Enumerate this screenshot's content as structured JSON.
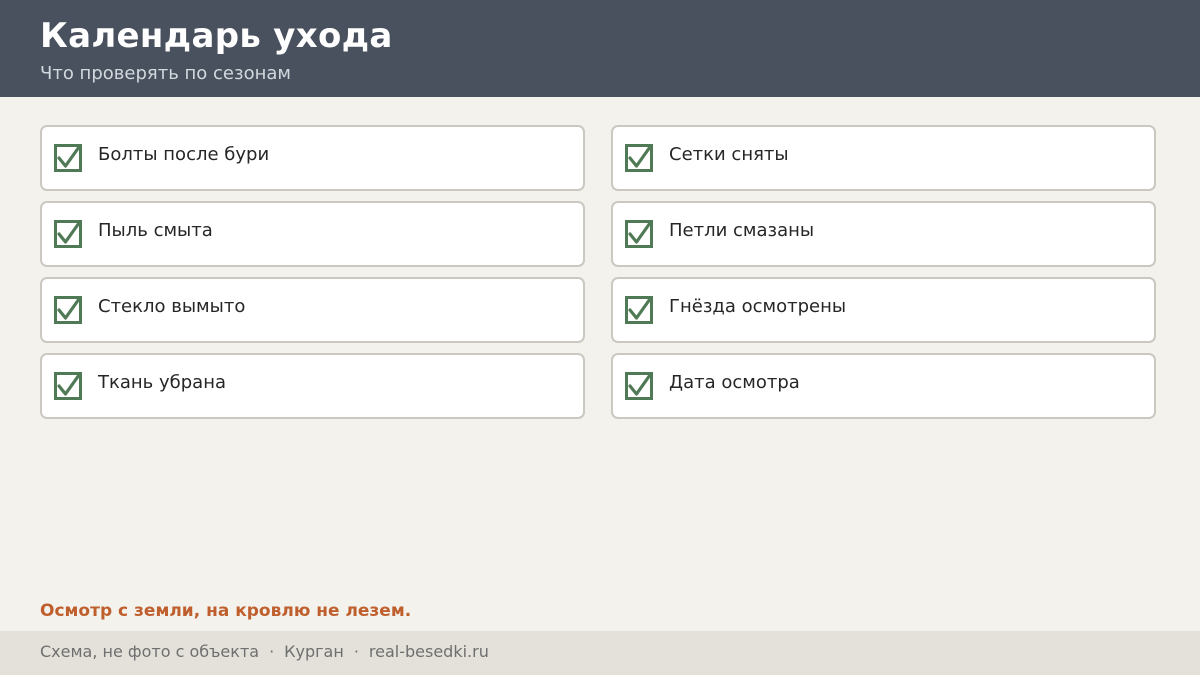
{
  "header": {
    "title": "Календарь ухода",
    "subtitle": "Что проверять по сезонам"
  },
  "colors": {
    "header_bg": "#48515d",
    "check_green": "#4f7a55",
    "warning": "#bf5f2d"
  },
  "checklist": [
    {
      "label": "Болты после бури",
      "checked": true,
      "icon": "checkbox-checked-icon"
    },
    {
      "label": "Сетки сняты",
      "checked": true,
      "icon": "checkbox-checked-icon"
    },
    {
      "label": "Пыль смыта",
      "checked": true,
      "icon": "checkbox-checked-icon"
    },
    {
      "label": "Петли смазаны",
      "checked": true,
      "icon": "checkbox-checked-icon"
    },
    {
      "label": "Стекло вымыто",
      "checked": true,
      "icon": "checkbox-checked-icon"
    },
    {
      "label": "Гнёзда осмотрены",
      "checked": true,
      "icon": "checkbox-checked-icon"
    },
    {
      "label": "Ткань убрана",
      "checked": true,
      "icon": "checkbox-checked-icon"
    },
    {
      "label": "Дата осмотра",
      "checked": true,
      "icon": "checkbox-checked-icon"
    }
  ],
  "warning": "Осмотр с земли, на кровлю не лезем.",
  "footer": {
    "note": "Схема, не фото с объекта",
    "separator": "·",
    "city": "Курган",
    "site": "real-besedki.ru"
  }
}
